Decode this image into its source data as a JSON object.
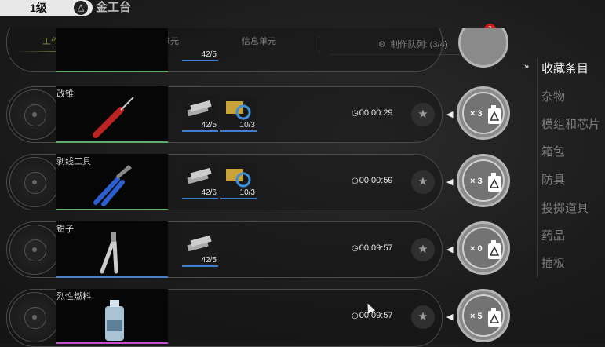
{
  "header": {
    "level": "1级",
    "level_icon": "△",
    "bench_title": "金工台"
  },
  "tabs": [
    {
      "label": "工作单元",
      "active": true
    },
    {
      "label": "武器单元",
      "active": false
    },
    {
      "label": "信息单元",
      "active": false
    }
  ],
  "queue": {
    "label": "制作队列: (3/4)",
    "badge": "1"
  },
  "partial_row": {
    "count": "42/5"
  },
  "rows": [
    {
      "name": "改锥",
      "bar_color": "#5fae6b",
      "mats": [
        "42/5",
        "10/3"
      ],
      "time": "00:00:29",
      "multiplier": "× 3"
    },
    {
      "name": "剥线工具",
      "bar_color": "#5fae6b",
      "mats": [
        "42/6",
        "10/3"
      ],
      "time": "00:00:59",
      "multiplier": "× 3"
    },
    {
      "name": "钳子",
      "bar_color": "#4b7fc4",
      "mats": [
        "42/5"
      ],
      "time": "00:09:57",
      "multiplier": "× 0"
    },
    {
      "name": "烈性燃料",
      "bar_color": "#c84fd1",
      "mats": [],
      "time": "00:09:57",
      "multiplier": "× 5"
    }
  ],
  "categories": [
    {
      "label": "收藏条目",
      "active": true
    },
    {
      "label": "杂物",
      "active": false
    },
    {
      "label": "模组和芯片",
      "active": false
    },
    {
      "label": "箱包",
      "active": false
    },
    {
      "label": "防具",
      "active": false
    },
    {
      "label": "投掷道具",
      "active": false
    },
    {
      "label": "药品",
      "active": false
    },
    {
      "label": "插板",
      "active": false
    }
  ],
  "icons": {
    "category_marker": "»",
    "clock": "◷",
    "star": "★",
    "arrow": "◀",
    "gear": "⚙"
  }
}
